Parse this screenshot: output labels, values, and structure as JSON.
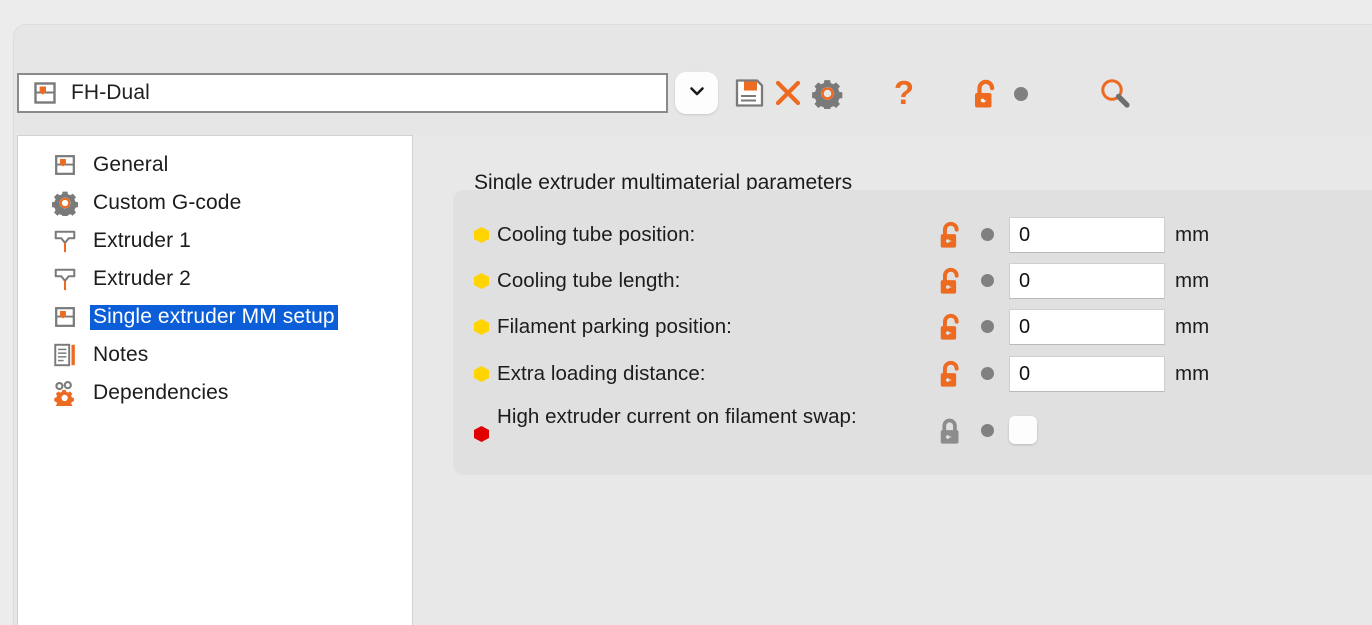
{
  "window": {
    "preset": {
      "value": "FH-Dual",
      "icon": "printer-preset-icon",
      "dropdown_icon": "chevron-down-icon"
    },
    "toolbar_buttons": [
      {
        "name": "save-preset-button",
        "icon": "floppy-disk-icon",
        "tooltip": "Save current settings"
      },
      {
        "name": "delete-preset-button",
        "icon": "close-x-icon",
        "tooltip": "Delete this preset"
      },
      {
        "name": "preset-settings-button",
        "icon": "gear-icon",
        "tooltip": "Preset settings"
      },
      {
        "name": "help-button",
        "icon": "question-mark-icon",
        "tooltip": "Help"
      },
      {
        "name": "lock-toggle-button",
        "icon": "unlocked-padlock-icon",
        "tooltip": "System value"
      },
      {
        "name": "search-button",
        "icon": "magnifier-icon",
        "tooltip": "Search"
      }
    ]
  },
  "sidebar": {
    "items": [
      {
        "label": "General",
        "icon": "printer-preset-icon",
        "selected": false
      },
      {
        "label": "Custom G-code",
        "icon": "gear-icon",
        "selected": false
      },
      {
        "label": "Extruder 1",
        "icon": "extruder-nozzle-icon",
        "selected": false
      },
      {
        "label": "Extruder 2",
        "icon": "extruder-nozzle-icon",
        "selected": false
      },
      {
        "label": "Single extruder MM setup",
        "icon": "printer-preset-icon",
        "selected": true
      },
      {
        "label": "Notes",
        "icon": "notes-document-icon",
        "selected": false
      },
      {
        "label": "Dependencies",
        "icon": "gears-dependencies-icon",
        "selected": false
      }
    ]
  },
  "main": {
    "title": "Single extruder multimaterial parameters",
    "parameters": [
      {
        "label": "Cooling tube position:",
        "bullet": "yellow-hex-bullet",
        "bullet_color": "#FFD400",
        "lock": "unlocked-padlock-icon",
        "lock_color": "#ED6B21",
        "control": "text",
        "value": "0",
        "unit": "mm"
      },
      {
        "label": "Cooling tube length:",
        "bullet": "yellow-hex-bullet",
        "bullet_color": "#FFD400",
        "lock": "unlocked-padlock-icon",
        "lock_color": "#ED6B21",
        "control": "text",
        "value": "0",
        "unit": "mm"
      },
      {
        "label": "Filament parking position:",
        "bullet": "yellow-hex-bullet",
        "bullet_color": "#FFD400",
        "lock": "unlocked-padlock-icon",
        "lock_color": "#ED6B21",
        "control": "text",
        "value": "0",
        "unit": "mm"
      },
      {
        "label": "Extra loading distance:",
        "bullet": "yellow-hex-bullet",
        "bullet_color": "#FFD400",
        "lock": "unlocked-padlock-icon",
        "lock_color": "#ED6B21",
        "control": "text",
        "value": "0",
        "unit": "mm"
      },
      {
        "label": "High extruder current on filament swap:",
        "bullet": "red-hex-bullet",
        "bullet_color": "#E00000",
        "lock": "locked-padlock-icon",
        "lock_color": "#8C8C8C",
        "control": "checkbox",
        "checked": false,
        "unit": ""
      }
    ]
  },
  "colors": {
    "accent_orange": "#ED6B21",
    "selection_blue": "#0B5ED7",
    "icon_grey": "#7A7A7A",
    "window_bg": "#E6E6E7",
    "panel_bg": "#E8E8E9",
    "group_bg": "#E0E0E1"
  }
}
